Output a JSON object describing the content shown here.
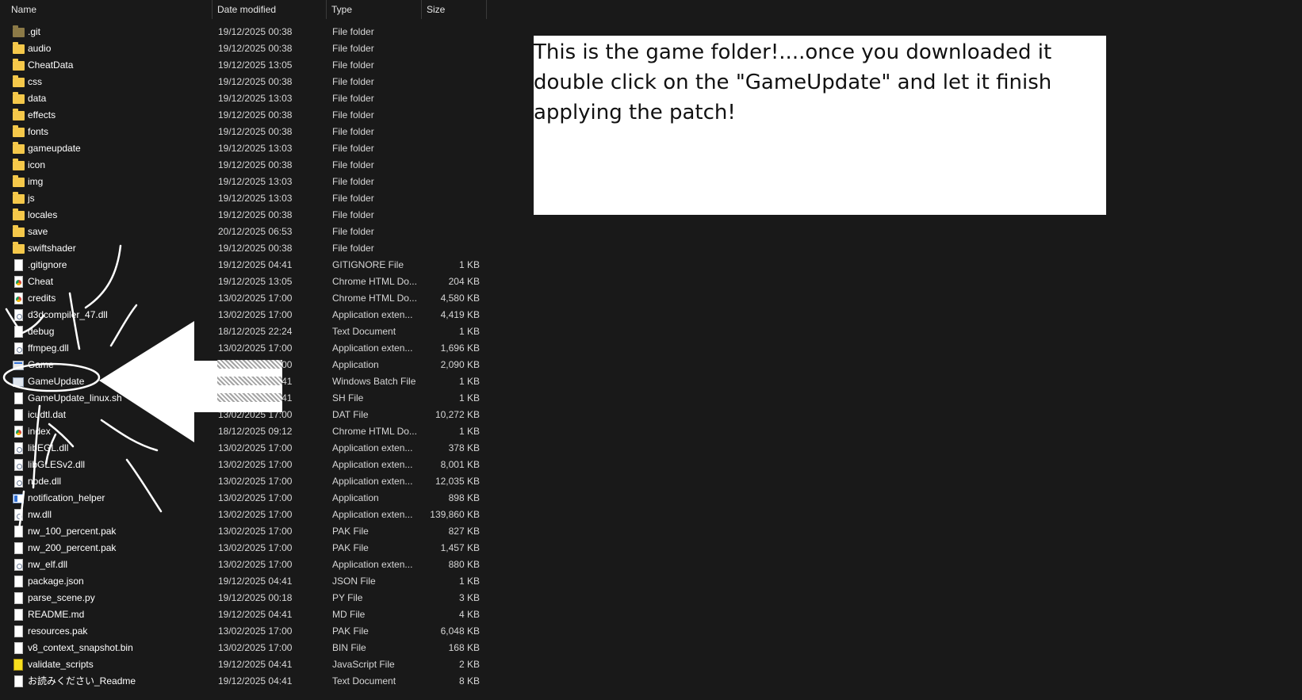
{
  "columns": {
    "name": "Name",
    "date_modified": "Date modified",
    "type": "Type",
    "size": "Size"
  },
  "files": [
    {
      "name": ".git",
      "date": "19/12/2025 00:38",
      "type": "File folder",
      "size": "",
      "icon": "folder-icon"
    },
    {
      "name": "audio",
      "date": "19/12/2025 00:38",
      "type": "File folder",
      "size": "",
      "icon": "folder-icon"
    },
    {
      "name": "CheatData",
      "date": "19/12/2025 13:05",
      "type": "File folder",
      "size": "",
      "icon": "folder-icon"
    },
    {
      "name": "css",
      "date": "19/12/2025 00:38",
      "type": "File folder",
      "size": "",
      "icon": "folder-icon"
    },
    {
      "name": "data",
      "date": "19/12/2025 13:03",
      "type": "File folder",
      "size": "",
      "icon": "folder-icon"
    },
    {
      "name": "effects",
      "date": "19/12/2025 00:38",
      "type": "File folder",
      "size": "",
      "icon": "folder-icon"
    },
    {
      "name": "fonts",
      "date": "19/12/2025 00:38",
      "type": "File folder",
      "size": "",
      "icon": "folder-icon"
    },
    {
      "name": "gameupdate",
      "date": "19/12/2025 13:03",
      "type": "File folder",
      "size": "",
      "icon": "folder-icon"
    },
    {
      "name": "icon",
      "date": "19/12/2025 00:38",
      "type": "File folder",
      "size": "",
      "icon": "folder-icon"
    },
    {
      "name": "img",
      "date": "19/12/2025 13:03",
      "type": "File folder",
      "size": "",
      "icon": "folder-icon"
    },
    {
      "name": "js",
      "date": "19/12/2025 13:03",
      "type": "File folder",
      "size": "",
      "icon": "folder-icon"
    },
    {
      "name": "locales",
      "date": "19/12/2025 00:38",
      "type": "File folder",
      "size": "",
      "icon": "folder-icon"
    },
    {
      "name": "save",
      "date": "20/12/2025 06:53",
      "type": "File folder",
      "size": "",
      "icon": "folder-icon"
    },
    {
      "name": "swiftshader",
      "date": "19/12/2025 00:38",
      "type": "File folder",
      "size": "",
      "icon": "folder-icon"
    },
    {
      "name": ".gitignore",
      "date": "19/12/2025 04:41",
      "type": "GITIGNORE File",
      "size": "1 KB",
      "icon": "file-icon"
    },
    {
      "name": "Cheat",
      "date": "19/12/2025 13:05",
      "type": "Chrome HTML Do...",
      "size": "204 KB",
      "icon": "chrome-icon"
    },
    {
      "name": "credits",
      "date": "13/02/2025 17:00",
      "type": "Chrome HTML Do...",
      "size": "4,580 KB",
      "icon": "chrome-icon"
    },
    {
      "name": "d3dcompiler_47.dll",
      "date": "13/02/2025 17:00",
      "type": "Application exten...",
      "size": "4,419 KB",
      "icon": "dll-icon"
    },
    {
      "name": "debug",
      "date": "18/12/2025 22:24",
      "type": "Text Document",
      "size": "1 KB",
      "icon": "file-icon"
    },
    {
      "name": "ffmpeg.dll",
      "date": "13/02/2025 17:00",
      "type": "Application exten...",
      "size": "1,696 KB",
      "icon": "dll-icon"
    },
    {
      "name": "Game",
      "date": "13/02/2025 17:00",
      "type": "Application",
      "size": "2,090 KB",
      "icon": "app-icon"
    },
    {
      "name": "GameUpdate",
      "date": "19/12/2025 04:41",
      "type": "Windows Batch File",
      "size": "1 KB",
      "icon": "batch-icon"
    },
    {
      "name": "GameUpdate_linux.sh",
      "date": "19/12/2025 04:41",
      "type": "SH File",
      "size": "1 KB",
      "icon": "file-icon"
    },
    {
      "name": "icudtl.dat",
      "date": "13/02/2025 17:00",
      "type": "DAT File",
      "size": "10,272 KB",
      "icon": "file-icon"
    },
    {
      "name": "index",
      "date": "18/12/2025 09:12",
      "type": "Chrome HTML Do...",
      "size": "1 KB",
      "icon": "chrome-icon"
    },
    {
      "name": "libEGL.dll",
      "date": "13/02/2025 17:00",
      "type": "Application exten...",
      "size": "378 KB",
      "icon": "dll-icon"
    },
    {
      "name": "libGLESv2.dll",
      "date": "13/02/2025 17:00",
      "type": "Application exten...",
      "size": "8,001 KB",
      "icon": "dll-icon"
    },
    {
      "name": "node.dll",
      "date": "13/02/2025 17:00",
      "type": "Application exten...",
      "size": "12,035 KB",
      "icon": "dll-icon"
    },
    {
      "name": "notification_helper",
      "date": "13/02/2025 17:00",
      "type": "Application",
      "size": "898 KB",
      "icon": "notification-app-icon"
    },
    {
      "name": "nw.dll",
      "date": "13/02/2025 17:00",
      "type": "Application exten...",
      "size": "139,860 KB",
      "icon": "dll-icon"
    },
    {
      "name": "nw_100_percent.pak",
      "date": "13/02/2025 17:00",
      "type": "PAK File",
      "size": "827 KB",
      "icon": "file-icon"
    },
    {
      "name": "nw_200_percent.pak",
      "date": "13/02/2025 17:00",
      "type": "PAK File",
      "size": "1,457 KB",
      "icon": "file-icon"
    },
    {
      "name": "nw_elf.dll",
      "date": "13/02/2025 17:00",
      "type": "Application exten...",
      "size": "880 KB",
      "icon": "dll-icon"
    },
    {
      "name": "package.json",
      "date": "19/12/2025 04:41",
      "type": "JSON File",
      "size": "1 KB",
      "icon": "file-icon"
    },
    {
      "name": "parse_scene.py",
      "date": "19/12/2025 00:18",
      "type": "PY File",
      "size": "3 KB",
      "icon": "file-icon"
    },
    {
      "name": "README.md",
      "date": "19/12/2025 04:41",
      "type": "MD File",
      "size": "4 KB",
      "icon": "file-icon"
    },
    {
      "name": "resources.pak",
      "date": "13/02/2025 17:00",
      "type": "PAK File",
      "size": "6,048 KB",
      "icon": "file-icon"
    },
    {
      "name": "v8_context_snapshot.bin",
      "date": "13/02/2025 17:00",
      "type": "BIN File",
      "size": "168 KB",
      "icon": "file-icon"
    },
    {
      "name": "validate_scripts",
      "date": "19/12/2025 04:41",
      "type": "JavaScript File",
      "size": "2 KB",
      "icon": "javascript-icon"
    },
    {
      "name": "お読みください_Readme",
      "date": "19/12/2025 04:41",
      "type": "Text Document",
      "size": "8 KB",
      "icon": "file-icon"
    }
  ],
  "instruction": {
    "text": "This is the game folder!....once you downloaded it double click on the \"GameUpdate\" and let it finish applying the patch!"
  },
  "colors": {
    "background": "#191919",
    "folder": "#f5c84a",
    "annotation": "#ffffff"
  }
}
